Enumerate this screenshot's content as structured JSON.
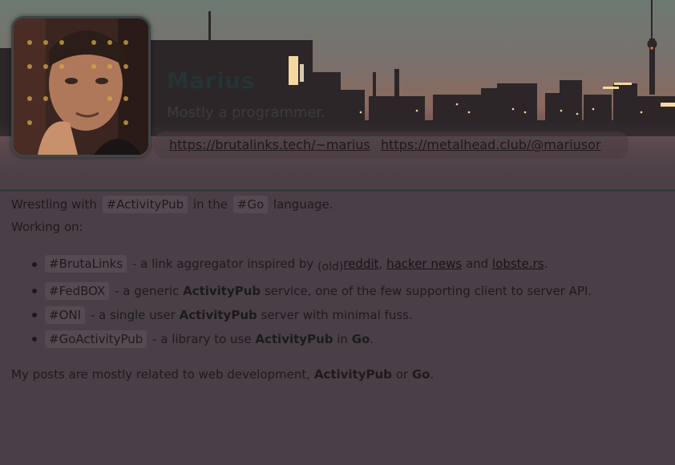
{
  "profile": {
    "name": "Marius",
    "tagline": "Mostly a programmer.",
    "links": [
      "https://brutalinks.tech/~marius",
      "https://metalhead.club/@mariusor"
    ]
  },
  "bio": {
    "intro": {
      "prefix": "Wrestling with",
      "tag1": "#ActivityPub",
      "middle": "in the",
      "tag2": "#Go",
      "suffix": "language."
    },
    "working_on_label": "Working on:",
    "projects": [
      {
        "tag": "#BrutaLinks",
        "text": "- a link aggregator inspired by",
        "old": "(old)",
        "link1": "reddit",
        "sep": ",",
        "link2": "hacker news",
        "and": "and",
        "link3": "lobste.rs",
        "end": "."
      },
      {
        "tag": "#FedBOX",
        "text": "- a generic",
        "bold": "ActivityPub",
        "rest": "service, one of the few supporting client to server API."
      },
      {
        "tag": "#ONI",
        "text": "- a single user",
        "bold": "ActivityPub",
        "rest": "server with minimal fuss."
      },
      {
        "tag": "#GoActivityPub",
        "text": "- a library to use",
        "bold": "ActivityPub",
        "in": "in",
        "bold2": "Go",
        "end": "."
      }
    ],
    "outro": {
      "text": "My posts are mostly related to web development,",
      "bold1": "ActivityPub",
      "or": "or",
      "bold2": "Go",
      "end": "."
    }
  }
}
